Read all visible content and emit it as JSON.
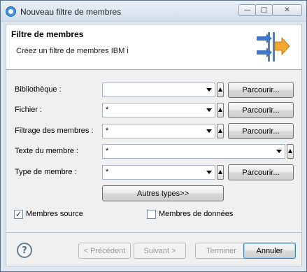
{
  "window": {
    "title": "Nouveau filtre de membres"
  },
  "header": {
    "title": "Filtre de membres",
    "description": "Créez un filtre de membres IBM i"
  },
  "form": {
    "bibliotheque": {
      "label": "Bibliothèque :",
      "value": ""
    },
    "fichier": {
      "label": "Fichier :",
      "value": "*"
    },
    "filtrage": {
      "label": "Filtrage des membres :",
      "value": "*"
    },
    "texte": {
      "label": "Texte du membre :",
      "value": "*"
    },
    "type": {
      "label": "Type de membre :",
      "value": "*"
    },
    "browse_label": "Parcourir...",
    "other_types_label": "Autres types>>",
    "members_source": {
      "label": "Membres source",
      "checked": true
    },
    "members_data": {
      "label": "Membres de données",
      "checked": false
    }
  },
  "footer": {
    "previous": "< Précédent",
    "next": "Suivant >",
    "finish": "Terminer",
    "cancel": "Annuler"
  }
}
